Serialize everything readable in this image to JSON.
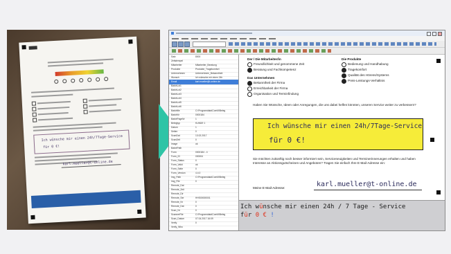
{
  "colors": {
    "accent": "#2ec4a6",
    "highlight": "#f6ec39",
    "ocr_error": "#e0321c"
  },
  "screen": {
    "fields": [
      {
        "k": "Satz",
        "v": "8000"
      },
      {
        "k": "Zeitstempel",
        "v": ""
      },
      {
        "k": "Mitarbeiter",
        "v": "Mitarbeiter_Beratung"
      },
      {
        "k": "Produkte",
        "v": "Produkte_Tragekomfort"
      },
      {
        "k": "Unternehmen",
        "v": "Unternehmen_Bekanntheit"
      },
      {
        "k": "Wunsch",
        "v": "Ich wünsche mir einen 24h"
      },
      {
        "k": "Email",
        "v": "karl.mueller@t-online.de"
      },
      {
        "k": "BatchLot1",
        "v": ""
      },
      {
        "k": "BatchLot2",
        "v": ""
      },
      {
        "k": "BatchLot3",
        "v": ""
      },
      {
        "k": "BatchLot4",
        "v": ""
      },
      {
        "k": "BatchLot5",
        "v": ""
      },
      {
        "k": "BatchLot6",
        "v": ""
      },
      {
        "k": "Batchfile",
        "v": "C:\\Programdata\\ComM\\Beleg"
      },
      {
        "k": "BatchNr",
        "v": "0000184"
      },
      {
        "k": "BatchPageNr",
        "v": "1"
      },
      {
        "k": "Belegtyp",
        "v": "KUNDE 1"
      },
      {
        "k": "Datum",
        "v": "1"
      },
      {
        "k": "Seiten",
        "v": "0"
      },
      {
        "k": "ScanDat",
        "v": "13.02.2017"
      },
      {
        "k": "ScanZeit",
        "v": "0"
      },
      {
        "k": "Image",
        "v": "ok"
      },
      {
        "k": "BatchPath",
        "v": ""
      },
      {
        "k": "Form",
        "v": "0000184 - 4"
      },
      {
        "k": "Form_ID",
        "v": "000004"
      },
      {
        "k": "Form_Status",
        "v": "0"
      },
      {
        "k": "Form_Valid",
        "v": "ok"
      },
      {
        "k": "Form_Seite",
        "v": "0"
      },
      {
        "k": "Form_Version",
        "v": "4.4.0"
      },
      {
        "k": "Img_Path",
        "v": "C:\\Programdata\\ComM\\Beleg"
      },
      {
        "k": "Img_File",
        "v": "0"
      },
      {
        "k": "Remote_Dat",
        "v": ""
      },
      {
        "k": "Remote_Zeit",
        "v": ""
      },
      {
        "k": "Remote_Dir",
        "v": ""
      },
      {
        "k": "Remote_Ser",
        "v": "HHS00000001"
      },
      {
        "k": "Remote_Nr",
        "v": "0"
      },
      {
        "k": "Remote_Dat",
        "v": "0"
      },
      {
        "k": "Scan_Nr",
        "v": "0"
      },
      {
        "k": "ScannerFile",
        "v": "C:\\Programdata\\ComM\\Beleg"
      },
      {
        "k": "Scan_Datum",
        "v": "07.04.2017 16:09"
      },
      {
        "k": "Verify",
        "v": "0"
      },
      {
        "k": "Verify_Who",
        "v": ""
      }
    ],
    "doc": {
      "q1_title": "Der / Die Mitarbeiter/in",
      "q1_opts": [
        "Freundlichkeit und genommene Zeit",
        "Beratung und Fachkompetenz"
      ],
      "q2_title": "Die Produkte",
      "q2_opts": [
        "Bedienung und Handhabung",
        "Tragekomfort",
        "Qualität des Hörens/Systems",
        "Preis-Leistungs-Verhältnis"
      ],
      "q3_title": "Das Unternehmen",
      "q3_opts": [
        "Bekanntheit der Firma",
        "Erreichbarkeit der Firma",
        "Organisation und Terminfindung"
      ],
      "wish_question": "Haben Sie Wünsche, Ideen oder Anregungen, die uns dabei helfen könnten, unseren Service weiter zu verbessern?",
      "hand1": "Ich wünsche mir einen 24h/7Tage-Service",
      "hand2": "für 0 €!",
      "info_text": "Sie möchten zukünftig noch besser informiert sein, Serviceneuigkeiten und Terminerinnerungen erhalten und haben Interesse an Aktionsgutscheinen und Angeboten? Tragen Sie einfach Ihre E-Mail-Adresse ein:",
      "email_label": "Meine E-Mail-Adresse:",
      "email_hand": "karl.mueller@t-online.de"
    },
    "ocr": {
      "l1a": "Ich w",
      "l1b": "ü",
      "l1c": "nsche mir einen 24h / 7 Tage - Service",
      "l2a": "f",
      "l2b": "ü",
      "l2c": "r ",
      "l2d": "0",
      "l2e": " ",
      "l2f": "€",
      "l2g": " !"
    }
  }
}
